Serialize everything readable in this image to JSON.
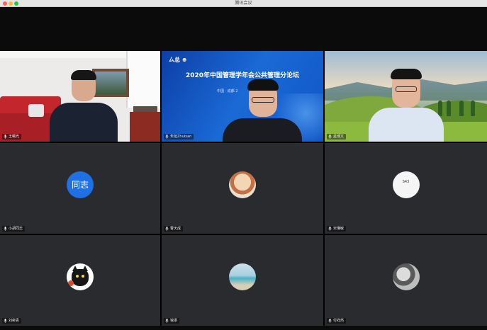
{
  "window": {
    "title": "腾讯会议"
  },
  "tiles": [
    {
      "type": "video",
      "name": "王曙光"
    },
    {
      "type": "video",
      "name": "朱旭Zhuixan",
      "banner_title": "2020年中国管理学年会公共管理分论坛",
      "banner_logo": "ㄙ总 ⊕",
      "banner_sub": "中国 · 成都  2"
    },
    {
      "type": "video",
      "name": "孟博文",
      "active": true
    },
    {
      "type": "avatar",
      "name": "小胡同志",
      "avatar_text": "同志",
      "avatar_color": "#1f6fe5"
    },
    {
      "type": "avatar",
      "name": "曹天成",
      "avatar_icon": "cartoon-avatar-icon"
    },
    {
      "type": "avatar",
      "name": "宋懂敏",
      "avatar_icon": "sketch-avatar-icon",
      "avatar_text": "S43"
    },
    {
      "type": "avatar",
      "name": "刘奕青",
      "avatar_icon": "black-cat-avatar-icon"
    },
    {
      "type": "avatar",
      "name": "锦添",
      "avatar_icon": "seascape-avatar-icon"
    },
    {
      "type": "avatar",
      "name": "付祥然",
      "avatar_icon": "bw-photo-avatar-icon"
    }
  ],
  "colors": {
    "active_speaker_border": "#2fd35a",
    "tile_background": "#2a2b2f"
  }
}
